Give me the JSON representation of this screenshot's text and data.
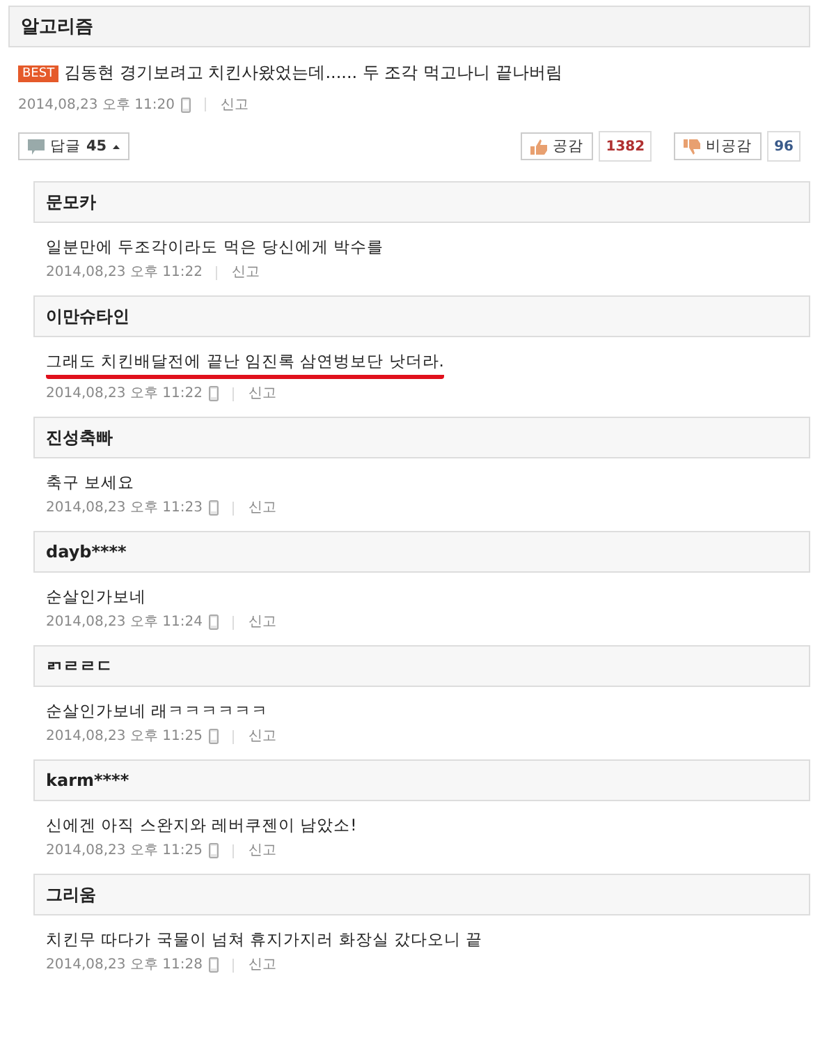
{
  "board": {
    "title": "알고리즘"
  },
  "post": {
    "badge": "BEST",
    "text": "김동현 경기보려고 치킨사왔었는데...... 두 조각 먹고나니 끝나버림",
    "date": "2014,08,23 오후 11:20",
    "mobile": true,
    "report": "신고"
  },
  "actions": {
    "reply_label": "답글",
    "reply_count": "45",
    "like_label": "공감",
    "like_count": "1382",
    "dislike_label": "비공감",
    "dislike_count": "96"
  },
  "comments": [
    {
      "author": "문모카",
      "text": "일분만에 두조각이라도 먹은 당신에게 박수를",
      "date": "2014,08,23 오후 11:22",
      "mobile": false,
      "report": "신고",
      "underlined": false
    },
    {
      "author": "이만슈타인",
      "text": "그래도 치킨배달전에 끝난 임진록 삼연벙보단 낫더라.",
      "date": "2014,08,23 오후 11:22",
      "mobile": true,
      "report": "신고",
      "underlined": true
    },
    {
      "author": "진성축빠",
      "text": "축구 보세요",
      "date": "2014,08,23 오후 11:23",
      "mobile": true,
      "report": "신고",
      "underlined": false
    },
    {
      "author": "dayb****",
      "text": "순살인가보네",
      "date": "2014,08,23 오후 11:24",
      "mobile": true,
      "report": "신고",
      "underlined": false
    },
    {
      "author": "ㄺㄹㄹㄷ",
      "text": "순살인가보네 래ㅋㅋㅋㅋㅋㅋ",
      "date": "2014,08,23 오후 11:25",
      "mobile": true,
      "report": "신고",
      "underlined": false
    },
    {
      "author": "karm****",
      "text": "신에겐 아직 스완지와 레버쿠젠이 남았소!",
      "date": "2014,08,23 오후 11:25",
      "mobile": true,
      "report": "신고",
      "underlined": false
    },
    {
      "author": "그리움",
      "text": "치킨무 따다가 국물이 넘쳐 휴지가지러 화장실 갔다오니 끝",
      "date": "2014,08,23 오후 11:28",
      "mobile": true,
      "report": "신고",
      "underlined": false
    }
  ]
}
